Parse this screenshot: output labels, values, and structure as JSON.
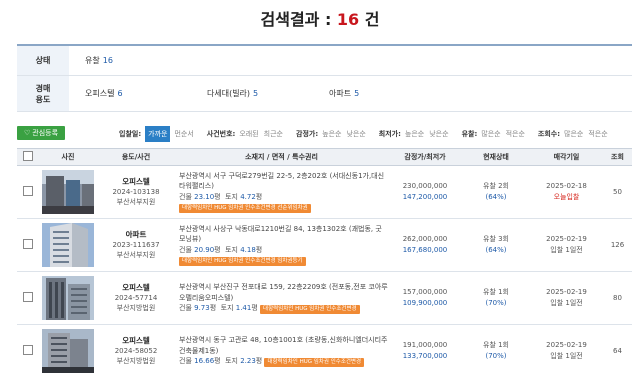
{
  "header": {
    "title_prefix": "검색결과 : ",
    "count": "16",
    "title_suffix": " 건"
  },
  "filters": {
    "status": {
      "label": "상태",
      "items": [
        {
          "label": "유찰",
          "count": "16"
        }
      ]
    },
    "usage": {
      "label": "경매\n용도",
      "items": [
        {
          "label": "오피스텔",
          "count": "6"
        },
        {
          "label": "다세대(빌라)",
          "count": "5"
        },
        {
          "label": "아파트",
          "count": "5"
        }
      ]
    }
  },
  "toolbar": {
    "fav_label": "관심등록",
    "sorts": [
      {
        "label": "입찰일:",
        "options": [
          "가까운",
          "먼순서"
        ],
        "active": 0
      },
      {
        "label": "사건번호:",
        "options": [
          "오래된",
          "최근순"
        ],
        "active": -1
      },
      {
        "label": "감정가:",
        "options": [
          "높은순",
          "낮은순"
        ],
        "active": -1
      },
      {
        "label": "최저가:",
        "options": [
          "높은순",
          "낮은순"
        ],
        "active": -1
      },
      {
        "label": "유찰:",
        "options": [
          "많은순",
          "적은순"
        ],
        "active": -1
      },
      {
        "label": "조회수:",
        "options": [
          "많은순",
          "적은순"
        ],
        "active": -1
      }
    ]
  },
  "table": {
    "headers": [
      "사진",
      "용도/사건",
      "소재지 / 면적 / 특수권리",
      "감정가/최저가",
      "현재상태",
      "매각기일",
      "조회"
    ],
    "rows": [
      {
        "type": "오피스텔",
        "case": "2024-103138",
        "court": "부산서부지원",
        "addr": "부산광역시 서구 구덕로279번길 22-5, 2층202호 (서대신동1가,대신타워팰리스)",
        "bld_label": "건물",
        "bld": "23.10",
        "land_label": "토지",
        "land": "4.72",
        "unit": "평",
        "tag": "대항력임차인 HUG 임차권 인수조건변경 선순위임차권",
        "appraisal": "230,000,000",
        "min": "147,200,000",
        "status": "유찰 2회",
        "pct": "(64%)",
        "date": "2025-02-18",
        "date_note": "오늘입찰",
        "views": "50"
      },
      {
        "type": "아파트",
        "case": "2023-111637",
        "court": "부산서부지원",
        "addr": "부산광역시 사상구 낙동대로1210번길 84, 13층1302호 (괘법동, 굿모닝뷰)",
        "bld_label": "건물",
        "bld": "20.90",
        "land_label": "토지",
        "land": "4.18",
        "unit": "평",
        "tag": "대항력임차인 HUG 임차권 인수조건변경 임차권등기",
        "appraisal": "262,000,000",
        "min": "167,680,000",
        "status": "유찰 3회",
        "pct": "(64%)",
        "date": "2025-02-19",
        "date_note": "입찰 1일전",
        "views": "126"
      },
      {
        "type": "오피스텔",
        "case": "2024-57714",
        "court": "부산지방법원",
        "addr": "부산광역시 부산진구 전포대로 159, 22층2209호 (전포동,전포 코아루 오펠리움오피스텔)",
        "bld_label": "건물",
        "bld": "9.73",
        "land_label": "토지",
        "land": "1.41",
        "unit": "평",
        "tag": "대항력임차인 HUG 임차권 인수조건변경",
        "appraisal": "157,000,000",
        "min": "109,900,000",
        "status": "유찰 1회",
        "pct": "(70%)",
        "date": "2025-02-19",
        "date_note": "입찰 1일전",
        "views": "80"
      },
      {
        "type": "오피스텔",
        "case": "2024-58052",
        "court": "부산지방법원",
        "addr": "부산광역시 동구 고관로 48, 10층1001호 (초량동,신화하니엘더시티주건축물제1동)",
        "bld_label": "건물",
        "bld": "16.66",
        "land_label": "토지",
        "land": "2.23",
        "unit": "평",
        "tag": "대항력임차인 HUG 임차권 인수조건변경",
        "appraisal": "191,000,000",
        "min": "133,700,000",
        "status": "유찰 1회",
        "pct": "(70%)",
        "date": "2025-02-19",
        "date_note": "입찰 1일전",
        "views": "64"
      }
    ]
  }
}
